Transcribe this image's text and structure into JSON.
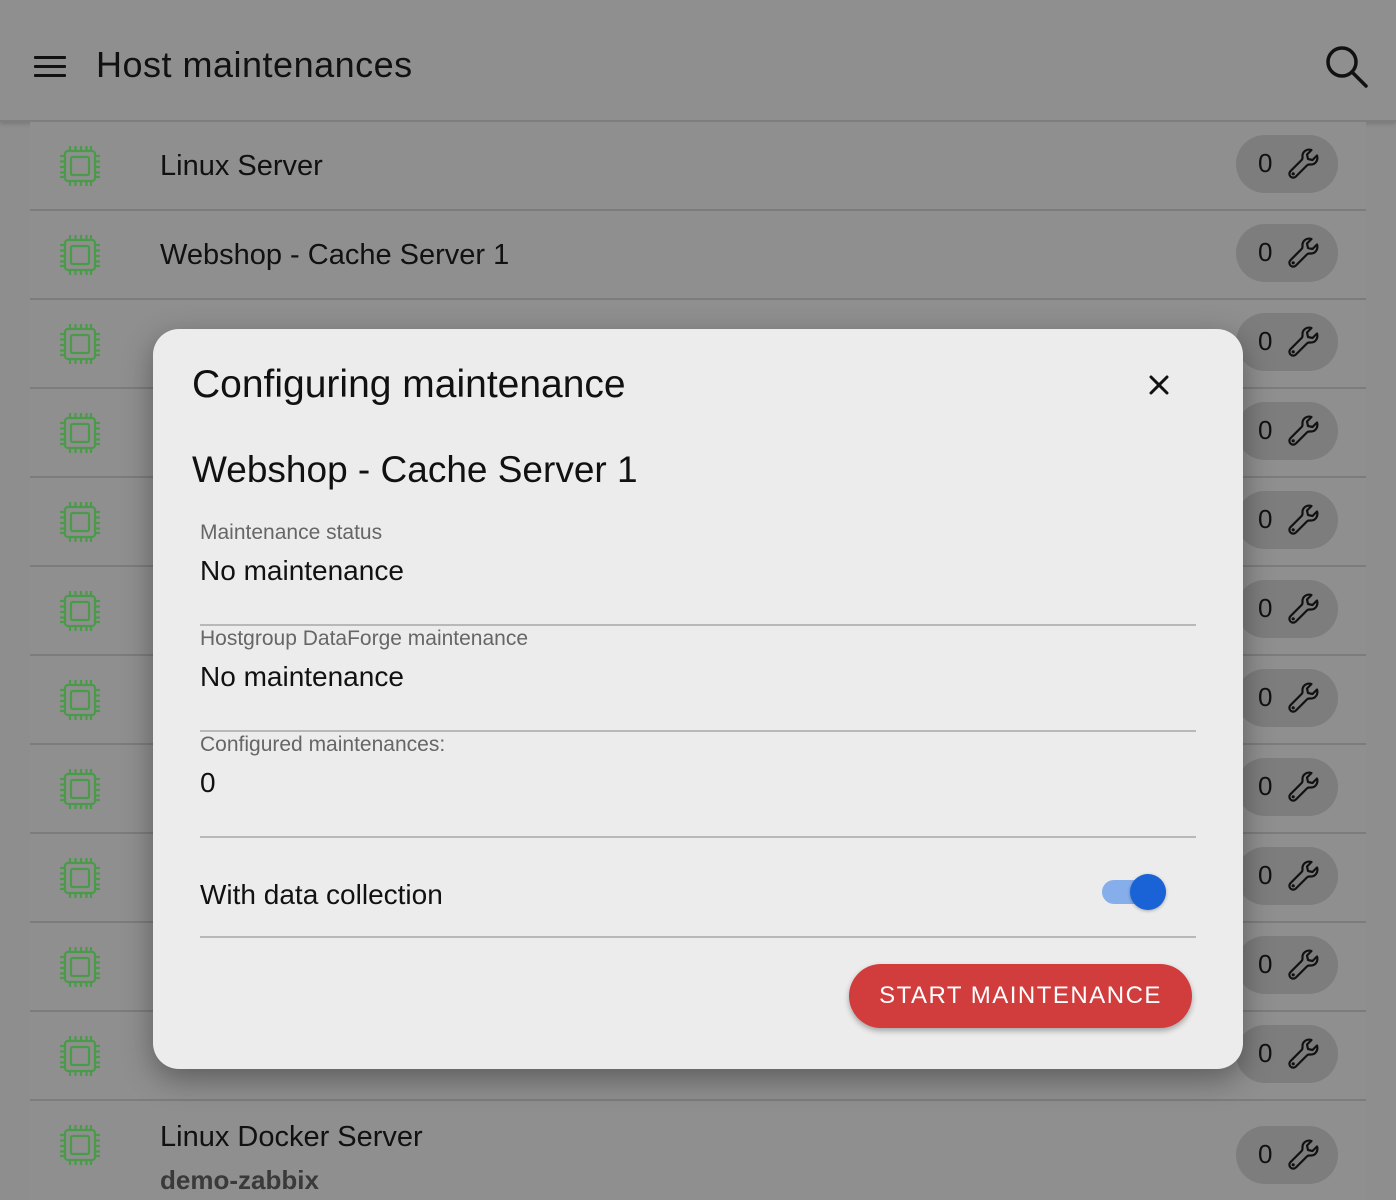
{
  "appbar": {
    "title": "Host maintenances",
    "menu_icon": "menu-icon",
    "search_icon": "search-icon"
  },
  "hosts": [
    {
      "name": "Linux Server",
      "group": "",
      "count": "0"
    },
    {
      "name": "Webshop - Cache Server 1",
      "group": "",
      "count": "0"
    },
    {
      "name": "",
      "group": "",
      "count": "0"
    },
    {
      "name": "",
      "group": "",
      "count": "0"
    },
    {
      "name": "",
      "group": "",
      "count": "0"
    },
    {
      "name": "",
      "group": "",
      "count": "0"
    },
    {
      "name": "",
      "group": "",
      "count": "0"
    },
    {
      "name": "",
      "group": "",
      "count": "0"
    },
    {
      "name": "",
      "group": "",
      "count": "0"
    },
    {
      "name": "",
      "group": "",
      "count": "0"
    },
    {
      "name": "",
      "group": "",
      "count": "0"
    },
    {
      "name": "Linux Docker Server",
      "group": "demo-zabbix",
      "count": "0"
    }
  ],
  "dialog": {
    "title": "Configuring maintenance",
    "host": "Webshop - Cache Server 1",
    "fields": {
      "status": {
        "label": "Maintenance status",
        "value": "No maintenance"
      },
      "hostgroup": {
        "label": "Hostgroup DataForge maintenance",
        "value": "No maintenance"
      },
      "configured": {
        "label": "Configured maintenances:",
        "value": "0"
      }
    },
    "toggle": {
      "label": "With data collection",
      "on": true
    },
    "start_button": "START MAINTENANCE"
  },
  "colors": {
    "chip_icon": "#4a9a4a",
    "accent_blue": "#1a63d6",
    "start_red": "#d13c3c"
  }
}
